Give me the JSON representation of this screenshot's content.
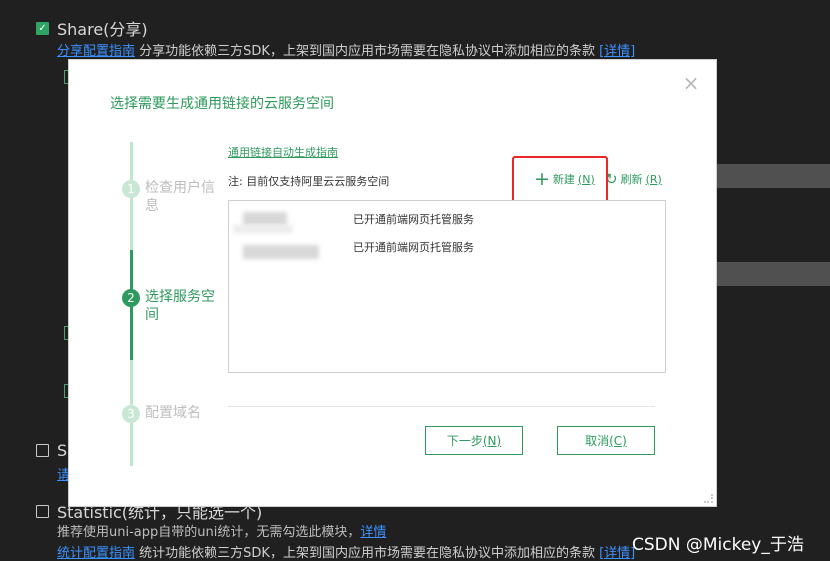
{
  "background": {
    "share_title": "Share(分享)",
    "share_guide_link": "分享配置指南",
    "share_desc": "分享功能依赖三方SDK，上架到国内应用市场需要在隐私协议中添加相应的条款",
    "detail_link": "[详情]",
    "row_s_letter": "S",
    "row_s_sub": "请",
    "statistic_title": "Statistic(统计，只能选一个)",
    "statistic_note": "推荐使用uni-app自带的uni统计，无需勾选此模块，",
    "statistic_detail": "详情",
    "stat_guide_link": "统计配置指南",
    "stat_desc": "统计功能依赖三方SDK，上架到国内应用市场需要在隐私协议中添加相应的条款",
    "stat_detail_link": "[详情]"
  },
  "dialog": {
    "title": "选择需要生成通用链接的云服务空间",
    "close": "×",
    "steps": [
      {
        "num": "1",
        "label": "检查用户信息"
      },
      {
        "num": "2",
        "label": "选择服务空间"
      },
      {
        "num": "3",
        "label": "配置域名"
      }
    ],
    "guide_link": "通用链接自动生成指南",
    "note": "注: 目前仅支持阿里云云服务空间",
    "new_label": "新建",
    "new_key": "(N)",
    "refresh_label": "刷新",
    "refresh_key": "(R)",
    "spaces": [
      {
        "status": "已开通前端网页托管服务"
      },
      {
        "status": "已开通前端网页托管服务"
      }
    ],
    "next_label": "下一步",
    "next_key": "(N)",
    "cancel_label": "取消",
    "cancel_key": "(C)"
  },
  "watermark": "CSDN @Mickey_于浩",
  "colors": {
    "accent": "#2f9a5d",
    "highlight": "#e8272a",
    "link": "#3b92ff",
    "background": "#202020"
  }
}
